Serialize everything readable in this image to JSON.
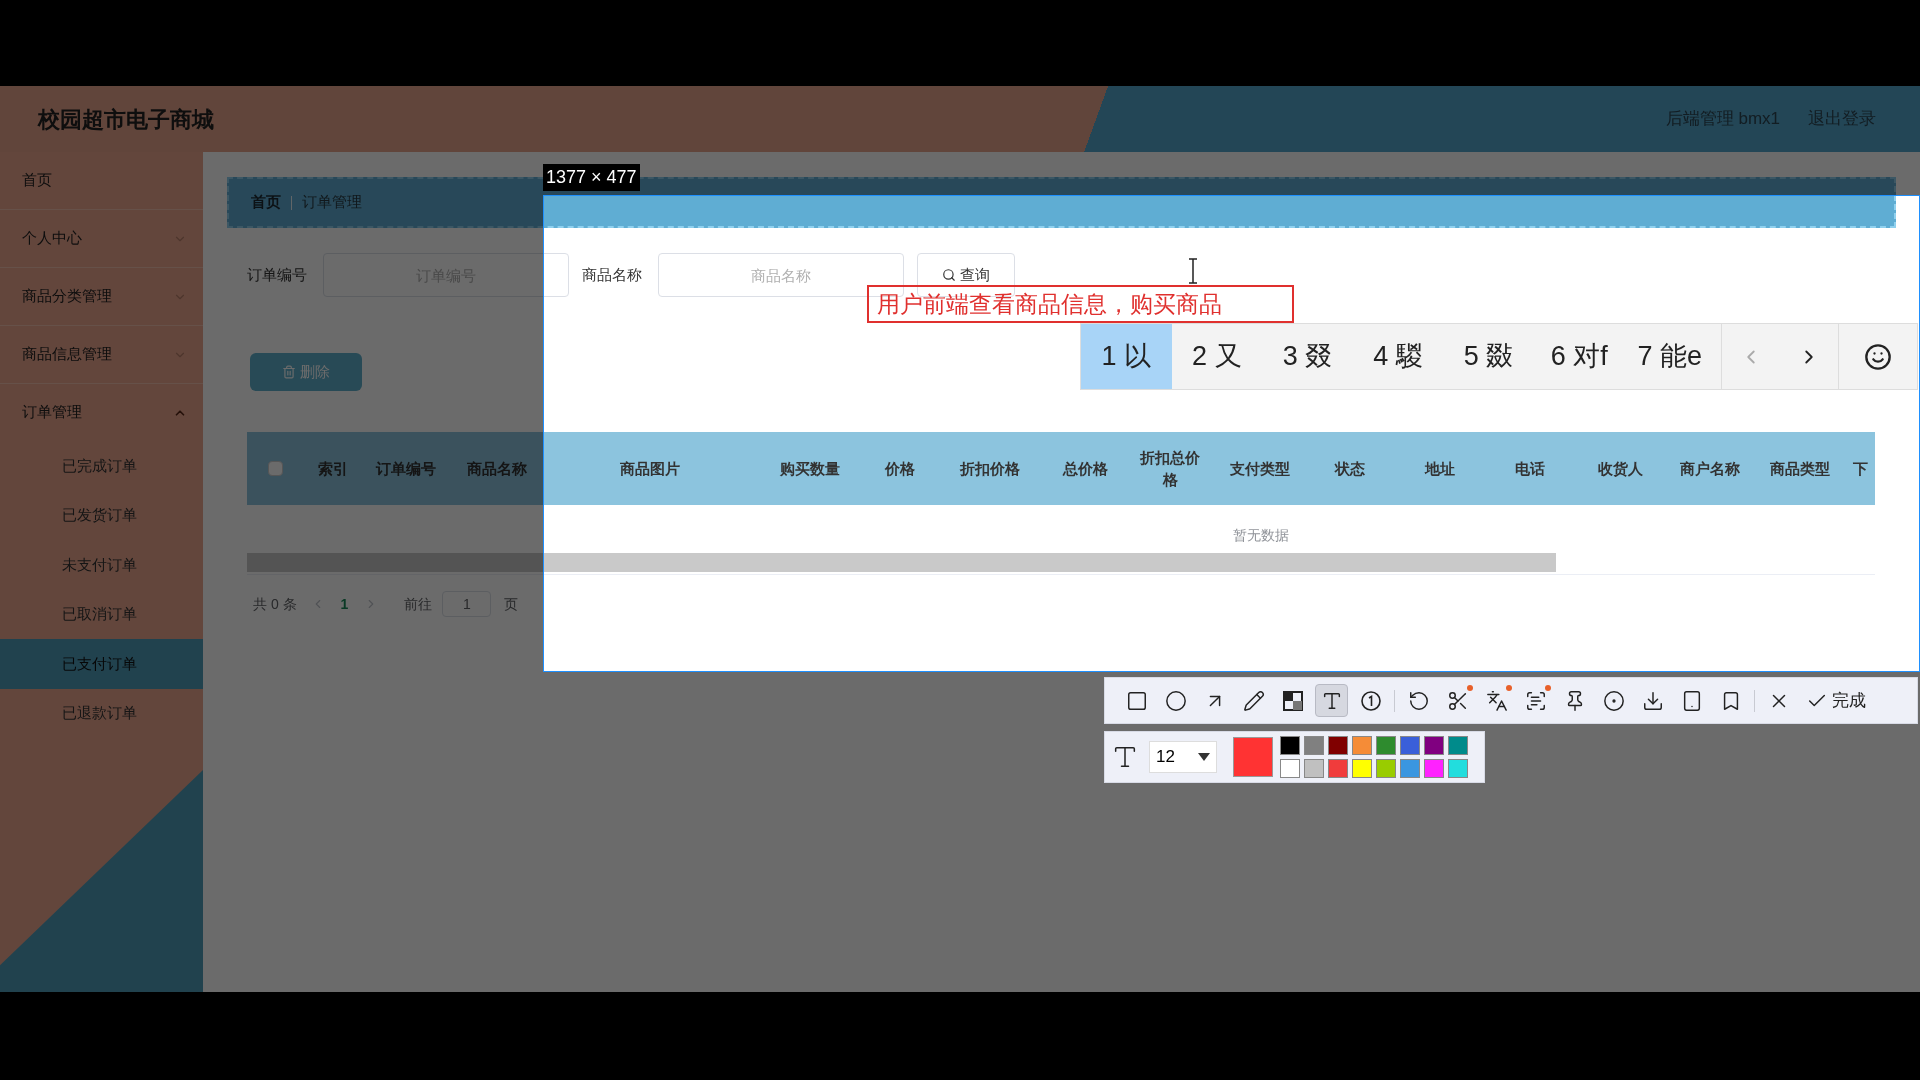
{
  "header": {
    "title": "校园超市电子商城",
    "links": [
      "后端管理 bmx1",
      "退出登录"
    ]
  },
  "sidebar": {
    "items": [
      {
        "label": "首页",
        "kind": "link"
      },
      {
        "label": "个人中心",
        "kind": "menu",
        "expanded": false
      },
      {
        "label": "商品分类管理",
        "kind": "menu",
        "expanded": false
      },
      {
        "label": "商品信息管理",
        "kind": "menu",
        "expanded": false
      },
      {
        "label": "订单管理",
        "kind": "menu",
        "expanded": true,
        "children": [
          {
            "label": "已完成订单",
            "selected": false
          },
          {
            "label": "已发货订单",
            "selected": false
          },
          {
            "label": "未支付订单",
            "selected": false
          },
          {
            "label": "已取消订单",
            "selected": false
          },
          {
            "label": "已支付订单",
            "selected": true
          },
          {
            "label": "已退款订单",
            "selected": false
          }
        ]
      }
    ]
  },
  "breadcrumb": [
    "首页",
    "订单管理"
  ],
  "search": {
    "fields": [
      {
        "label": "订单编号",
        "placeholder": "订单编号"
      },
      {
        "label": "商品名称",
        "placeholder": "商品名称"
      }
    ],
    "button": "查询"
  },
  "delete_button": "删除",
  "table": {
    "header_checkbox": {
      "checked": false
    },
    "columns": [
      "索引",
      "订单编号",
      "商品名称",
      "商品图片",
      "购买数量",
      "价格",
      "折扣价格",
      "总价格",
      "折扣总价格",
      "支付类型",
      "状态",
      "地址",
      "电话",
      "收货人",
      "商户名称",
      "商品类型",
      "下"
    ],
    "empty_text": "暂无数据"
  },
  "pagination": {
    "total": "共 0 条",
    "pages": [
      {
        "label": "1",
        "selected": true
      }
    ],
    "goto_label": "前往",
    "goto_value": "1",
    "page_suffix": "页"
  },
  "capture": {
    "size_label": "1377 × 477",
    "annotation": "用户前端查看商品信息，购买商品",
    "candidates": [
      {
        "label": "1 以",
        "selected": true
      },
      {
        "label": "2 又",
        "selected": false
      },
      {
        "label": "3 叕",
        "selected": false
      },
      {
        "label": "4 騣",
        "selected": false
      },
      {
        "label": "5 敠",
        "selected": false
      },
      {
        "label": "6 对f",
        "selected": false
      },
      {
        "label": "7 能e",
        "selected": false
      }
    ],
    "tools": [
      {
        "kind": "rect",
        "selected": false,
        "dot": false
      },
      {
        "kind": "ellipse",
        "selected": false,
        "dot": false
      },
      {
        "kind": "arrow",
        "selected": false,
        "dot": false
      },
      {
        "kind": "pencil",
        "selected": false,
        "dot": false
      },
      {
        "kind": "mosaic",
        "selected": false,
        "dot": false
      },
      {
        "kind": "text",
        "selected": true,
        "dot": false
      },
      {
        "kind": "counter",
        "selected": false,
        "dot": false
      },
      {
        "kind": "separator"
      },
      {
        "kind": "undo",
        "selected": false,
        "dot": false
      },
      {
        "kind": "cut",
        "selected": false,
        "dot": true
      },
      {
        "kind": "translate",
        "selected": false,
        "dot": true
      },
      {
        "kind": "scan",
        "selected": false,
        "dot": true
      },
      {
        "kind": "pin",
        "selected": false,
        "dot": false
      },
      {
        "kind": "record",
        "selected": false,
        "dot": false
      },
      {
        "kind": "download",
        "selected": false,
        "dot": false
      },
      {
        "kind": "device",
        "selected": false,
        "dot": false
      },
      {
        "kind": "bookmark",
        "selected": false,
        "dot": false
      },
      {
        "kind": "separator"
      },
      {
        "kind": "close",
        "selected": false,
        "dot": false
      }
    ],
    "done": "完成",
    "font_size": "12",
    "current_swatch": {
      "color": "#ff3333"
    },
    "palette": [
      {
        "color": "#000000"
      },
      {
        "color": "#808080"
      },
      {
        "color": "#800000"
      },
      {
        "color": "#f58c37"
      },
      {
        "color": "#2e8b2e"
      },
      {
        "color": "#3a5fd9"
      },
      {
        "color": "#800080"
      },
      {
        "color": "#008b8b"
      },
      {
        "color": "#ffffff"
      },
      {
        "color": "#c0c0c0"
      },
      {
        "color": "#f03c3c"
      },
      {
        "color": "#ffff00"
      },
      {
        "color": "#99cc00"
      },
      {
        "color": "#3a96e0"
      },
      {
        "color": "#ff22ff"
      },
      {
        "color": "#22dddd"
      }
    ]
  }
}
